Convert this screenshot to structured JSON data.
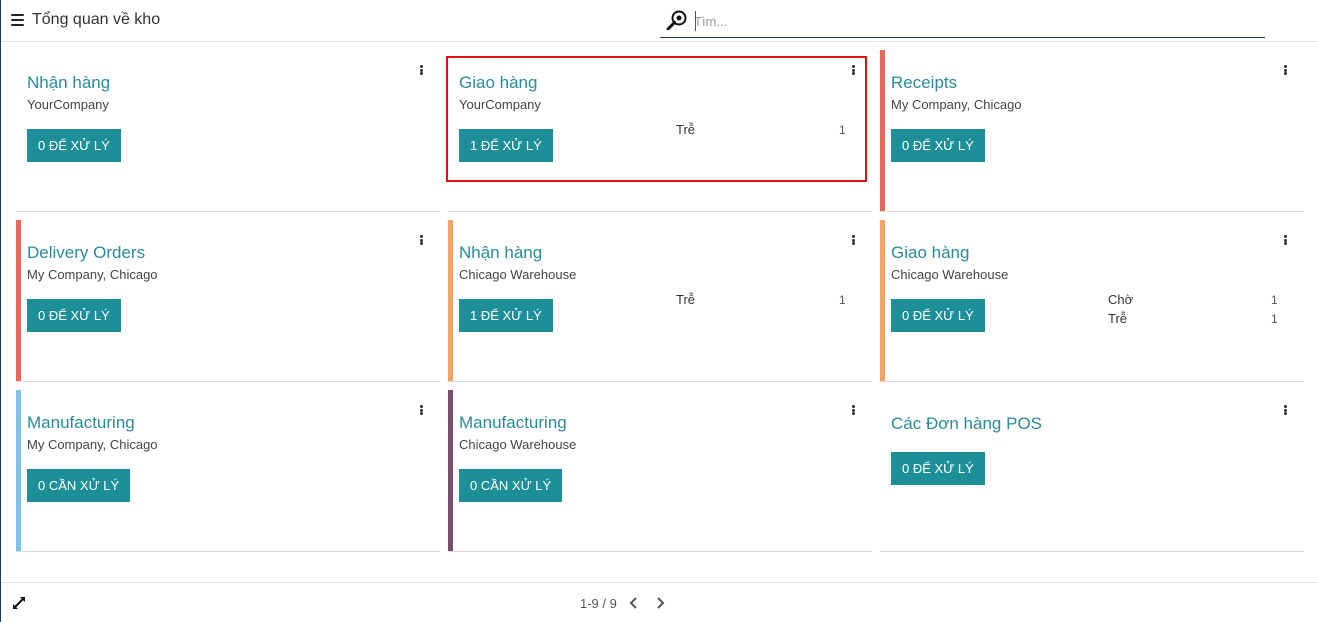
{
  "header": {
    "title": "Tổng quan về kho",
    "search_placeholder": "Tìm..."
  },
  "cards": [
    {
      "title": "Nhận hàng",
      "subtitle": "YourCompany",
      "button": "0 ĐỂ XỬ LÝ",
      "stripe_color": "",
      "stats": []
    },
    {
      "title": "Giao hàng",
      "subtitle": "YourCompany",
      "button": "1 ĐỂ XỬ LÝ",
      "stripe_color": "",
      "stats": [
        {
          "label": "Trễ",
          "value": "1"
        }
      ]
    },
    {
      "title": "Receipts",
      "subtitle": "My Company, Chicago",
      "button": "0 ĐỂ XỬ LÝ",
      "stripe_color": "#e8695c",
      "stats": []
    },
    {
      "title": "Delivery Orders",
      "subtitle": "My Company, Chicago",
      "button": "0 ĐỂ XỬ LÝ",
      "stripe_color": "#e8695c",
      "stats": []
    },
    {
      "title": "Nhận hàng",
      "subtitle": "Chicago Warehouse",
      "button": "1 ĐỂ XỬ LÝ",
      "stripe_color": "#f4a460",
      "stats": [
        {
          "label": "Trễ",
          "value": "1"
        }
      ]
    },
    {
      "title": "Giao hàng",
      "subtitle": "Chicago Warehouse",
      "button": "0 ĐỂ XỬ LÝ",
      "stripe_color": "#f4a460",
      "stats": [
        {
          "label": "Chờ",
          "value": "1"
        },
        {
          "label": "Trễ",
          "value": "1"
        }
      ]
    },
    {
      "title": "Manufacturing",
      "subtitle": "My Company, Chicago",
      "button": "0 CẦN XỬ LÝ",
      "stripe_color": "#7fc4e8",
      "stats": []
    },
    {
      "title": "Manufacturing",
      "subtitle": "Chicago Warehouse",
      "button": "0 CẦN XỬ LÝ",
      "stripe_color": "#7a4f6e",
      "stats": []
    },
    {
      "title": "Các Đơn hàng POS",
      "subtitle": "",
      "button": "0 ĐỂ XỬ LÝ",
      "stripe_color": "",
      "stats": []
    }
  ],
  "pager": {
    "range": "1-9 / 9"
  },
  "colors": {
    "accent": "#1d8f98",
    "title": "#2a8b9a",
    "highlight": "#e01010"
  }
}
